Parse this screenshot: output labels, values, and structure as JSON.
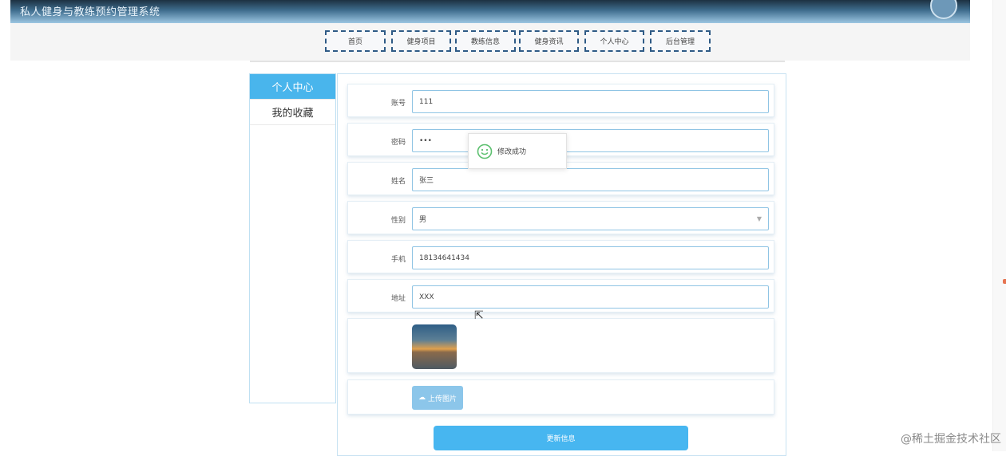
{
  "header": {
    "title": "私人健身与教练预约管理系统"
  },
  "nav": [
    {
      "label": "首页"
    },
    {
      "label": "健身项目"
    },
    {
      "label": "教练信息"
    },
    {
      "label": "健身资讯"
    },
    {
      "label": "个人中心"
    },
    {
      "label": "后台管理"
    }
  ],
  "sidebar": {
    "items": [
      {
        "label": "个人中心",
        "active": true
      },
      {
        "label": "我的收藏",
        "active": false
      }
    ]
  },
  "form": {
    "account_label": "账号",
    "account_value": "111",
    "password_label": "密码",
    "password_value": "•••",
    "name_label": "姓名",
    "name_value": "张三",
    "gender_label": "性别",
    "gender_value": "男",
    "phone_label": "手机",
    "phone_value": "18134641434",
    "address_label": "地址",
    "address_value": "XXX",
    "upload_label": "上传图片",
    "submit_label": "更新信息"
  },
  "toast": {
    "message": "修改成功",
    "icon": "smile-icon"
  },
  "watermark": "@稀土掘金技术社区",
  "colors": {
    "accent": "#47b6f0",
    "nav_border": "#2f5b86",
    "header_dark": "#1d3142"
  }
}
